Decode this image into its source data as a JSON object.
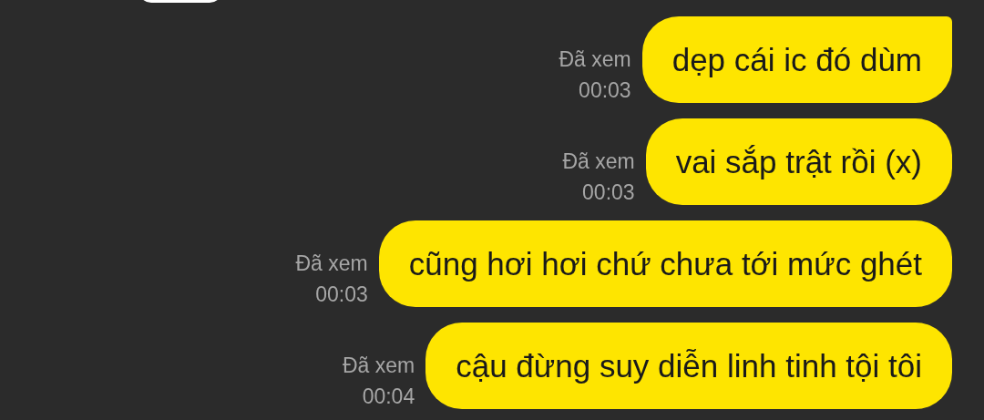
{
  "messages": [
    {
      "text": "dẹp cái ic đó dùm",
      "read_status": "Đã xem",
      "time": "00:03",
      "tail": true
    },
    {
      "text": "vai sắp trật rồi (x)",
      "read_status": "Đã xem",
      "time": "00:03",
      "tail": false
    },
    {
      "text": "cũng hơi hơi chứ chưa tới mức ghét",
      "read_status": "Đã xem",
      "time": "00:03",
      "tail": false
    },
    {
      "text": "cậu đừng suy diễn linh tinh tội tôi",
      "read_status": "Đã xem",
      "time": "00:04",
      "tail": false
    }
  ]
}
